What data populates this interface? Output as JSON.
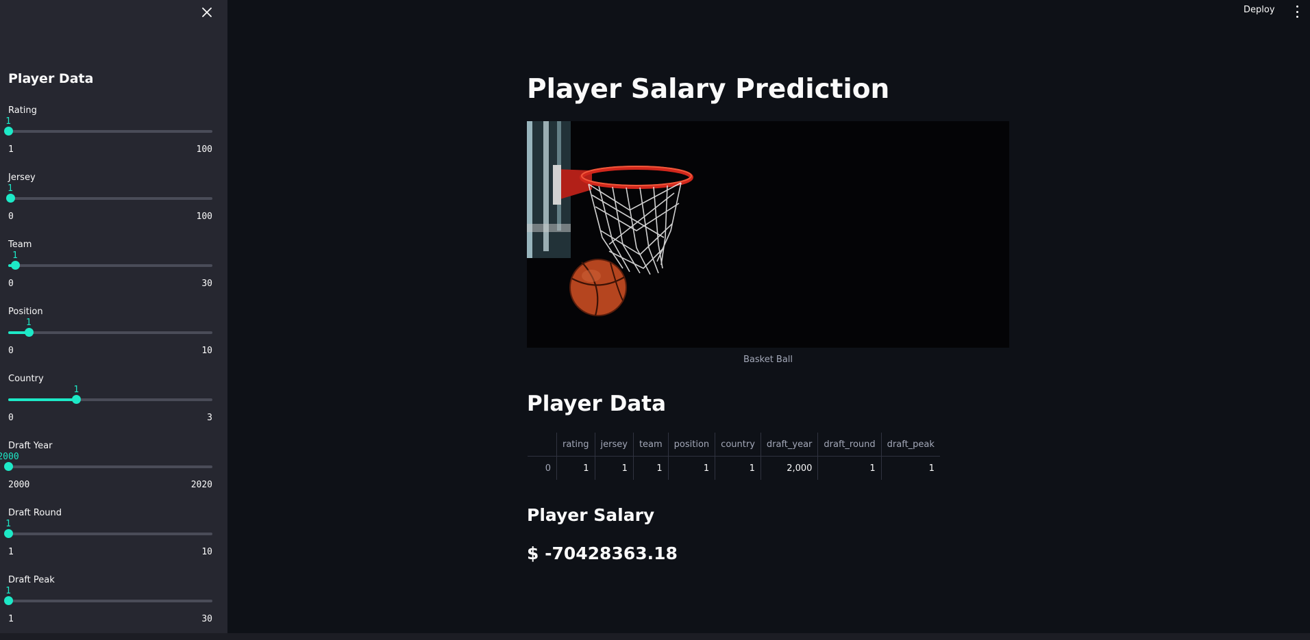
{
  "header": {
    "deploy_label": "Deploy",
    "menu_icon": "more-vertical-icon"
  },
  "sidebar": {
    "close_icon": "close-icon",
    "title": "Player Data",
    "sliders": [
      {
        "label": "Rating",
        "value": "1",
        "min": "1",
        "max": "100",
        "fraction": 0.0
      },
      {
        "label": "Jersey",
        "value": "1",
        "min": "0",
        "max": "100",
        "fraction": 0.01
      },
      {
        "label": "Team",
        "value": "1",
        "min": "0",
        "max": "30",
        "fraction": 0.0333
      },
      {
        "label": "Position",
        "value": "1",
        "min": "0",
        "max": "10",
        "fraction": 0.1
      },
      {
        "label": "Country",
        "value": "1",
        "min": "0",
        "max": "3",
        "fraction": 0.3333
      },
      {
        "label": "Draft Year",
        "value": "2000",
        "min": "2000",
        "max": "2020",
        "fraction": 0.0
      },
      {
        "label": "Draft Round",
        "value": "1",
        "min": "1",
        "max": "10",
        "fraction": 0.0
      },
      {
        "label": "Draft Peak",
        "value": "1",
        "min": "1",
        "max": "30",
        "fraction": 0.0
      }
    ]
  },
  "main": {
    "title": "Player Salary Prediction",
    "image_caption": "Basket Ball",
    "data_heading": "Player Data",
    "table": {
      "columns": [
        "",
        "rating",
        "jersey",
        "team",
        "position",
        "country",
        "draft_year",
        "draft_round",
        "draft_peak"
      ],
      "rows": [
        [
          "0",
          "1",
          "1",
          "1",
          "1",
          "1",
          "2,000",
          "1",
          "1"
        ]
      ]
    },
    "salary_heading": "Player Salary",
    "salary_value": "$ -70428363.18"
  },
  "colors": {
    "accent": "#1de9c7",
    "background": "#0e1117",
    "sidebar": "#262730"
  }
}
